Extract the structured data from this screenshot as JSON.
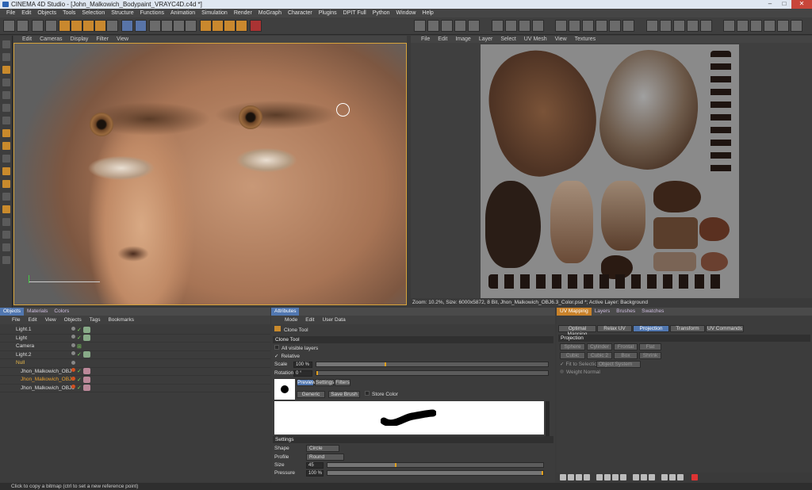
{
  "window": {
    "title": "CINEMA 4D Studio - [John_Malkowich_Bodypaint_VRAYC4D.c4d *]",
    "min": "–",
    "max": "□",
    "close": "✕"
  },
  "menu": [
    "File",
    "Edit",
    "Objects",
    "Tools",
    "Selection",
    "Structure",
    "Functions",
    "Animation",
    "Simulation",
    "Render",
    "MoGraph",
    "Character",
    "Plugins",
    "DPIT Full",
    "Python",
    "Window",
    "Help"
  ],
  "viewport": {
    "menu": [
      "Edit",
      "Cameras",
      "Display",
      "Filter",
      "View"
    ]
  },
  "texture_view": {
    "menu": [
      "File",
      "Edit",
      "Image",
      "Layer",
      "Select",
      "UV Mesh",
      "View",
      "Textures"
    ],
    "status": "Zoom: 10.2%, Size: 6000x5872, 8 Bit, Jhon_Malkowich_OBJ6.3_Color.psd *; Active Layer: Background"
  },
  "objects_panel": {
    "tabs": [
      "Objects",
      "Materials",
      "Colors"
    ],
    "menu": [
      "File",
      "Edit",
      "View",
      "Objects",
      "Tags",
      "Bookmarks"
    ],
    "rows": [
      {
        "name": "Light.1"
      },
      {
        "name": "Light"
      },
      {
        "name": "Camera"
      },
      {
        "name": "Light.2"
      },
      {
        "name": "Null"
      },
      {
        "name": "Jhon_Malkowich_OBJ"
      },
      {
        "name": "Jhon_Malkowich_OBJ1"
      },
      {
        "name": "Jhon_Malkowich_OBJ6"
      }
    ]
  },
  "attributes": {
    "tab": "Attributes",
    "menu": [
      "Mode",
      "Edit",
      "User Data"
    ],
    "tool_name": "Clone Tool",
    "section": "Clone Tool",
    "all_visible_layers": "All visible layers",
    "relative": "Relative",
    "scale_label": "Scale",
    "scale_value": "100 %",
    "rotation_label": "Rotation",
    "rotation_value": "0 °",
    "preview_tabs": [
      "Preview",
      "Settings",
      "Filters"
    ],
    "generic": "Generic",
    "save_brush": "Save Brush",
    "store_color": "Store Color",
    "settings_section": "Settings",
    "shape_label": "Shape",
    "shape_value": "Circle",
    "profile_label": "Profile",
    "profile_value": "Round",
    "size_label": "Size",
    "size_value": "45",
    "pressure_label": "Pressure",
    "pressure_value": "100 %"
  },
  "uv_panel": {
    "tabs": [
      "UV Mapping",
      "Layers",
      "Brushes",
      "Swatches"
    ],
    "subtabs": [
      "Optimal Mapping",
      "Relax UV",
      "Projection",
      "Transform",
      "UV Commands"
    ],
    "section": "Projection",
    "buttons": [
      "Sphere",
      "Cylinder",
      "Frontal",
      "Flat",
      "Cubic",
      "Cubic 2",
      "Box",
      "Shrink"
    ],
    "fit": "Fit to Selection",
    "coord": "Object System",
    "weight": "Weight Normal"
  },
  "statusbar": {
    "text": "Click to copy a bitmap (ctrl to set a new reference point)"
  }
}
